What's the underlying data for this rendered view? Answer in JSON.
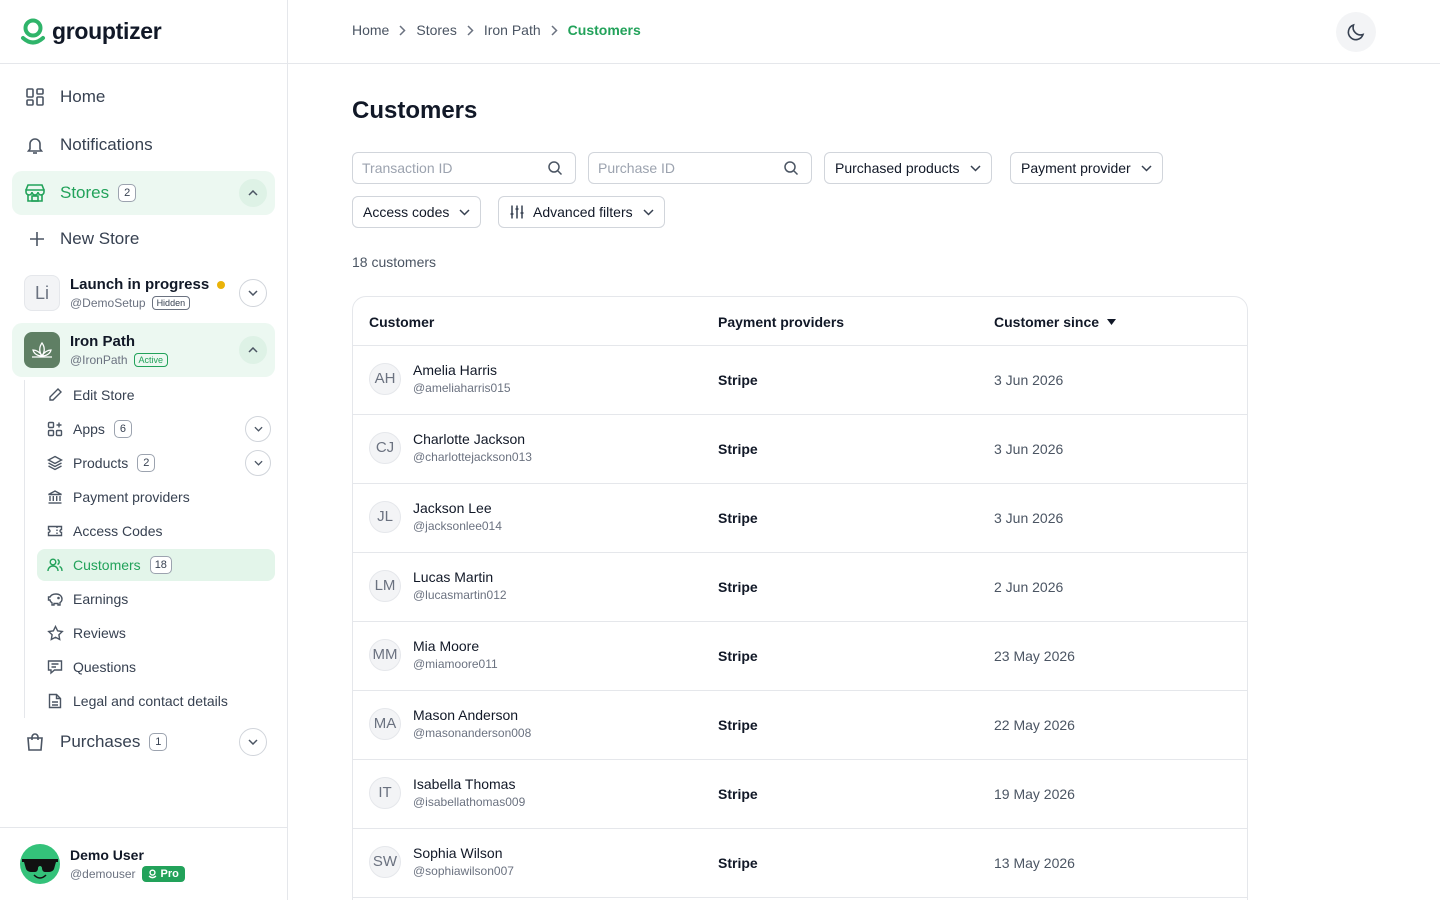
{
  "brand": {
    "name": "grouptizer",
    "accent": "#22a25a"
  },
  "sidebar": {
    "nav": [
      {
        "label": "Home",
        "icon": "dashboard-icon"
      },
      {
        "label": "Notifications",
        "icon": "bell-icon"
      },
      {
        "label": "Stores",
        "icon": "store-icon",
        "count": "2"
      },
      {
        "label": "New Store",
        "icon": "plus-icon"
      }
    ],
    "stores": [
      {
        "initials": "Li",
        "name": "Launch in progress",
        "handle": "@DemoSetup",
        "tag": "Hidden"
      },
      {
        "name": "Iron Path",
        "handle": "@IronPath",
        "tag": "Active"
      }
    ],
    "sub_items": [
      {
        "label": "Edit Store",
        "icon": "pencil-icon"
      },
      {
        "label": "Apps",
        "icon": "apps-icon",
        "count": "6"
      },
      {
        "label": "Products",
        "icon": "layers-icon",
        "count": "2"
      },
      {
        "label": "Payment providers",
        "icon": "bank-icon"
      },
      {
        "label": "Access Codes",
        "icon": "ticket-icon"
      },
      {
        "label": "Customers",
        "icon": "users-icon",
        "count": "18"
      },
      {
        "label": "Earnings",
        "icon": "piggy-bank-icon"
      },
      {
        "label": "Reviews",
        "icon": "star-icon"
      },
      {
        "label": "Questions",
        "icon": "message-icon"
      },
      {
        "label": "Legal and contact details",
        "icon": "document-icon"
      }
    ],
    "purchases": {
      "label": "Purchases",
      "count": "1"
    },
    "user": {
      "name": "Demo User",
      "handle": "@demouser",
      "badge": "Pro"
    }
  },
  "breadcrumb": [
    "Home",
    "Stores",
    "Iron Path",
    "Customers"
  ],
  "page": {
    "title": "Customers",
    "filters": {
      "transaction_placeholder": "Transaction ID",
      "purchase_placeholder": "Purchase ID",
      "purchased_products": "Purchased products",
      "payment_provider": "Payment provider",
      "access_codes": "Access codes",
      "advanced": "Advanced filters"
    },
    "count_text": "18 customers"
  },
  "table": {
    "columns": [
      "Customer",
      "Payment providers",
      "Customer since"
    ],
    "rows": [
      {
        "initials": "AH",
        "name": "Amelia Harris",
        "handle": "@ameliaharris015",
        "provider": "Stripe",
        "since": "3 Jun 2026"
      },
      {
        "initials": "CJ",
        "name": "Charlotte Jackson",
        "handle": "@charlottejackson013",
        "provider": "Stripe",
        "since": "3 Jun 2026"
      },
      {
        "initials": "JL",
        "name": "Jackson Lee",
        "handle": "@jacksonlee014",
        "provider": "Stripe",
        "since": "3 Jun 2026"
      },
      {
        "initials": "LM",
        "name": "Lucas Martin",
        "handle": "@lucasmartin012",
        "provider": "Stripe",
        "since": "2 Jun 2026"
      },
      {
        "initials": "MM",
        "name": "Mia Moore",
        "handle": "@miamoore011",
        "provider": "Stripe",
        "since": "23 May 2026"
      },
      {
        "initials": "MA",
        "name": "Mason Anderson",
        "handle": "@masonanderson008",
        "provider": "Stripe",
        "since": "22 May 2026"
      },
      {
        "initials": "IT",
        "name": "Isabella Thomas",
        "handle": "@isabellathomas009",
        "provider": "Stripe",
        "since": "19 May 2026"
      },
      {
        "initials": "SW",
        "name": "Sophia Wilson",
        "handle": "@sophiawilson007",
        "provider": "Stripe",
        "since": "13 May 2026"
      }
    ]
  }
}
